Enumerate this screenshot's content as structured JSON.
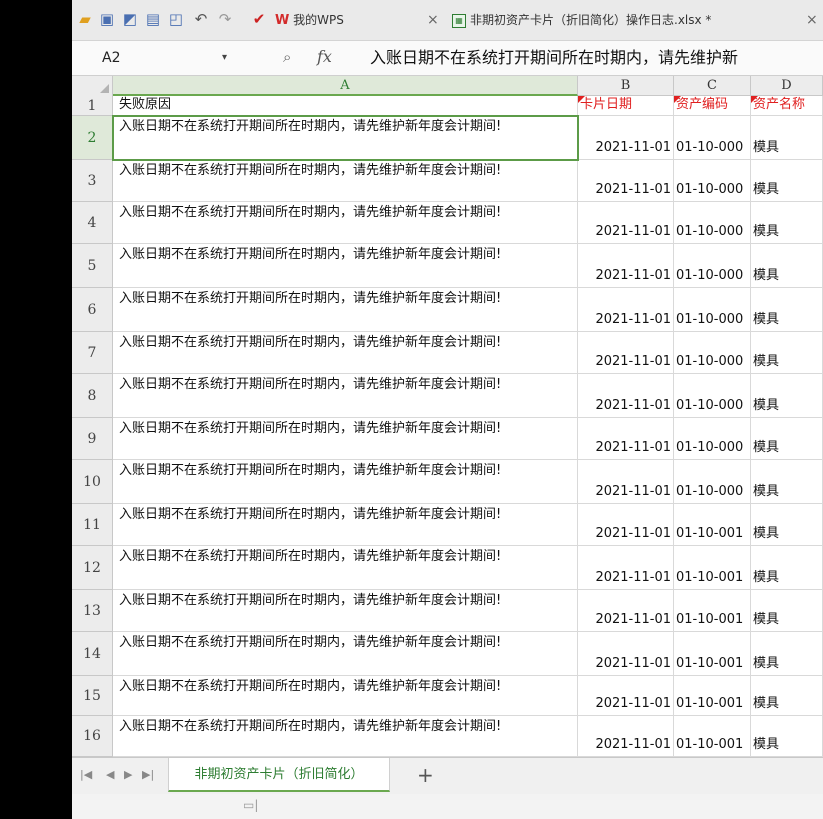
{
  "toolbar": {
    "tab_mywps": "我的WPS",
    "tab_file": "非期初资产卡片（折旧简化）操作日志.xlsx *",
    "close_glyph": "×",
    "icons": [
      "open-folder-icon",
      "save-icon",
      "export-icon",
      "print-icon",
      "print-preview-icon",
      "undo-icon",
      "redo-icon",
      "customize-icon"
    ]
  },
  "formula_bar": {
    "name_box": "A2",
    "dropdown_glyph": "▾",
    "fx_label": "fx",
    "formula": "入账日期不在系统打开期间所在时期内，请先维护新"
  },
  "columns": [
    {
      "letter": "A"
    },
    {
      "letter": "B"
    },
    {
      "letter": "C"
    },
    {
      "letter": "D"
    }
  ],
  "header_row": {
    "number": "1",
    "a": "失败原因",
    "b": "卡片日期",
    "c": "资产编码",
    "d": "资产名称"
  },
  "rows": [
    {
      "number": "2",
      "a": "入账日期不在系统打开期间所在时期内，请先维护新年度会计期间!",
      "b": "2021-11-01",
      "c": "01-10-000",
      "d": "模具"
    },
    {
      "number": "3",
      "a": "入账日期不在系统打开期间所在时期内，请先维护新年度会计期间!",
      "b": "2021-11-01",
      "c": "01-10-000",
      "d": "模具"
    },
    {
      "number": "4",
      "a": "入账日期不在系统打开期间所在时期内，请先维护新年度会计期间!",
      "b": "2021-11-01",
      "c": "01-10-000",
      "d": "模具"
    },
    {
      "number": "5",
      "a": "入账日期不在系统打开期间所在时期内，请先维护新年度会计期间!",
      "b": "2021-11-01",
      "c": "01-10-000",
      "d": "模具"
    },
    {
      "number": "6",
      "a": "入账日期不在系统打开期间所在时期内，请先维护新年度会计期间!",
      "b": "2021-11-01",
      "c": "01-10-000",
      "d": "模具"
    },
    {
      "number": "7",
      "a": "入账日期不在系统打开期间所在时期内，请先维护新年度会计期间!",
      "b": "2021-11-01",
      "c": "01-10-000",
      "d": "模具"
    },
    {
      "number": "8",
      "a": "入账日期不在系统打开期间所在时期内，请先维护新年度会计期间!",
      "b": "2021-11-01",
      "c": "01-10-000",
      "d": "模具"
    },
    {
      "number": "9",
      "a": "入账日期不在系统打开期间所在时期内，请先维护新年度会计期间!",
      "b": "2021-11-01",
      "c": "01-10-000",
      "d": "模具"
    },
    {
      "number": "10",
      "a": "入账日期不在系统打开期间所在时期内，请先维护新年度会计期间!",
      "b": "2021-11-01",
      "c": "01-10-000",
      "d": "模具"
    },
    {
      "number": "11",
      "a": "入账日期不在系统打开期间所在时期内，请先维护新年度会计期间!",
      "b": "2021-11-01",
      "c": "01-10-001",
      "d": "模具"
    },
    {
      "number": "12",
      "a": "入账日期不在系统打开期间所在时期内，请先维护新年度会计期间!",
      "b": "2021-11-01",
      "c": "01-10-001",
      "d": "模具"
    },
    {
      "number": "13",
      "a": "入账日期不在系统打开期间所在时期内，请先维护新年度会计期间!",
      "b": "2021-11-01",
      "c": "01-10-001",
      "d": "模具"
    },
    {
      "number": "14",
      "a": "入账日期不在系统打开期间所在时期内，请先维护新年度会计期间!",
      "b": "2021-11-01",
      "c": "01-10-001",
      "d": "模具"
    },
    {
      "number": "15",
      "a": "入账日期不在系统打开期间所在时期内，请先维护新年度会计期间!",
      "b": "2021-11-01",
      "c": "01-10-001",
      "d": "模具"
    },
    {
      "number": "16",
      "a": "入账日期不在系统打开期间所在时期内，请先维护新年度会计期间!",
      "b": "2021-11-01",
      "c": "01-10-001",
      "d": "模具"
    }
  ],
  "sheet_tabs": {
    "active": "非期初资产卡片（折旧简化）",
    "add_glyph": "+"
  },
  "colors": {
    "accent_green": "#2e7d32",
    "selection_green": "#5c9b48",
    "header_red": "#e02020"
  }
}
